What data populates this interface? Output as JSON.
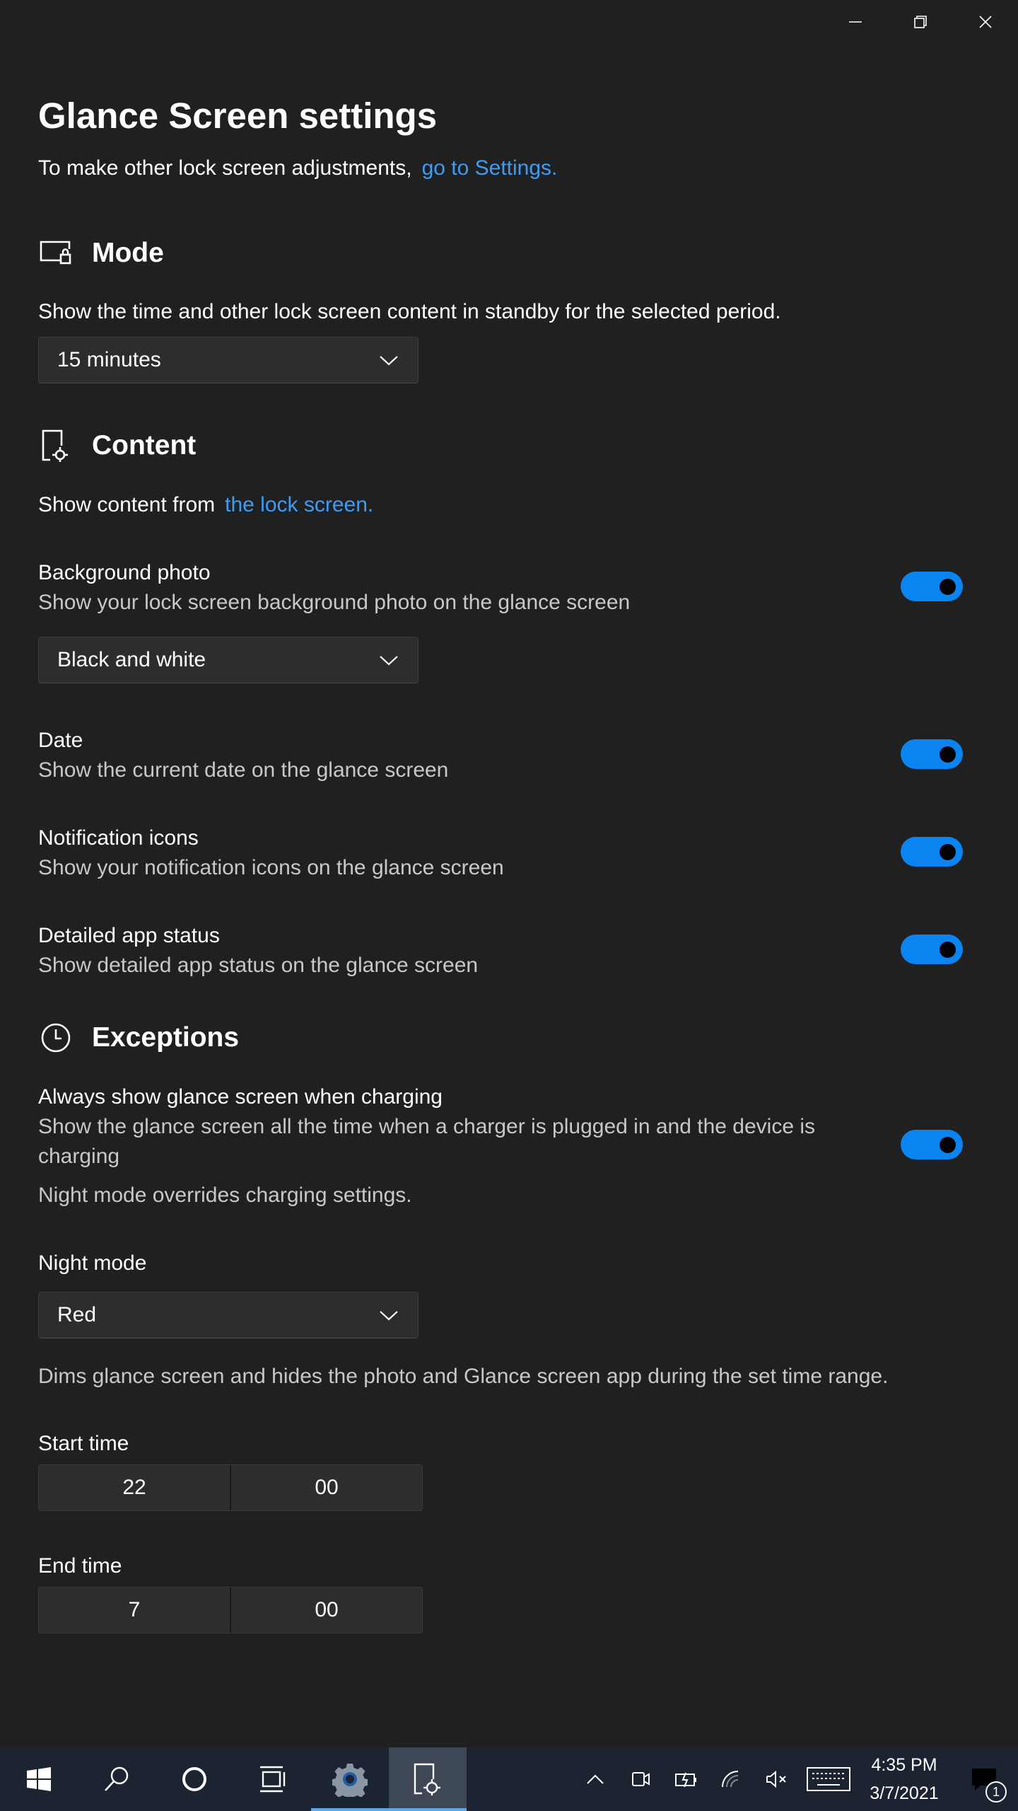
{
  "window": {
    "caption": {
      "minimize_icon": "minimize-icon",
      "restore_icon": "restore-icon",
      "close_icon": "close-icon"
    }
  },
  "page": {
    "title": "Glance Screen settings",
    "intro_text": "To make other lock screen adjustments,",
    "intro_link": "go to Settings."
  },
  "mode": {
    "heading": "Mode",
    "icon": "lock-screen-icon",
    "description": "Show the time and other lock screen content in standby for the selected period.",
    "timeout_value": "15 minutes"
  },
  "content": {
    "heading": "Content",
    "icon": "device-settings-icon",
    "source_text": "Show content from",
    "source_link": "the lock screen.",
    "background_photo": {
      "label": "Background photo",
      "description": "Show your lock screen background photo on the glance screen",
      "on": true,
      "style_value": "Black and white"
    },
    "date": {
      "label": "Date",
      "description": "Show the current date on the glance screen",
      "on": true
    },
    "notification_icons": {
      "label": "Notification icons",
      "description": "Show your notification icons on the glance screen",
      "on": true
    },
    "detailed_app_status": {
      "label": "Detailed app status",
      "description": "Show detailed app status on the glance screen",
      "on": true
    }
  },
  "exceptions": {
    "heading": "Exceptions",
    "icon": "clock-icon",
    "charging": {
      "label": "Always show glance screen when charging",
      "description_line1": "Show the glance screen all the time when a charger is plugged in and the device is",
      "description_line2": "charging",
      "on": true
    },
    "override_note": "Night mode overrides charging settings.",
    "night_mode": {
      "label": "Night mode",
      "value": "Red",
      "description": "Dims glance screen and hides the photo and Glance screen app during the set time range."
    },
    "start_time": {
      "label": "Start time",
      "hour": "22",
      "minute": "00"
    },
    "end_time": {
      "label": "End time",
      "hour": "7",
      "minute": "00"
    }
  },
  "taskbar": {
    "start_icon": "windows-start-icon",
    "search_icon": "search-icon",
    "cortana_icon": "cortana-icon",
    "task_view_icon": "task-view-icon",
    "settings_app_icon": "settings-gear-icon",
    "glance_app_icon": "device-settings-icon",
    "tray": [
      "chevron-up-icon",
      "meet-now-icon",
      "battery-charging-icon",
      "wifi-icon",
      "volume-muted-icon",
      "touch-keyboard-icon"
    ],
    "time": "4:35 PM",
    "date": "3/7/2021",
    "notification_count": "1",
    "accent_color": "#5aa8ea"
  },
  "colors": {
    "background": "#202020",
    "toggle_on": "#0a84f0",
    "link": "#3b9ef6",
    "taskbar": "#1b2430"
  }
}
